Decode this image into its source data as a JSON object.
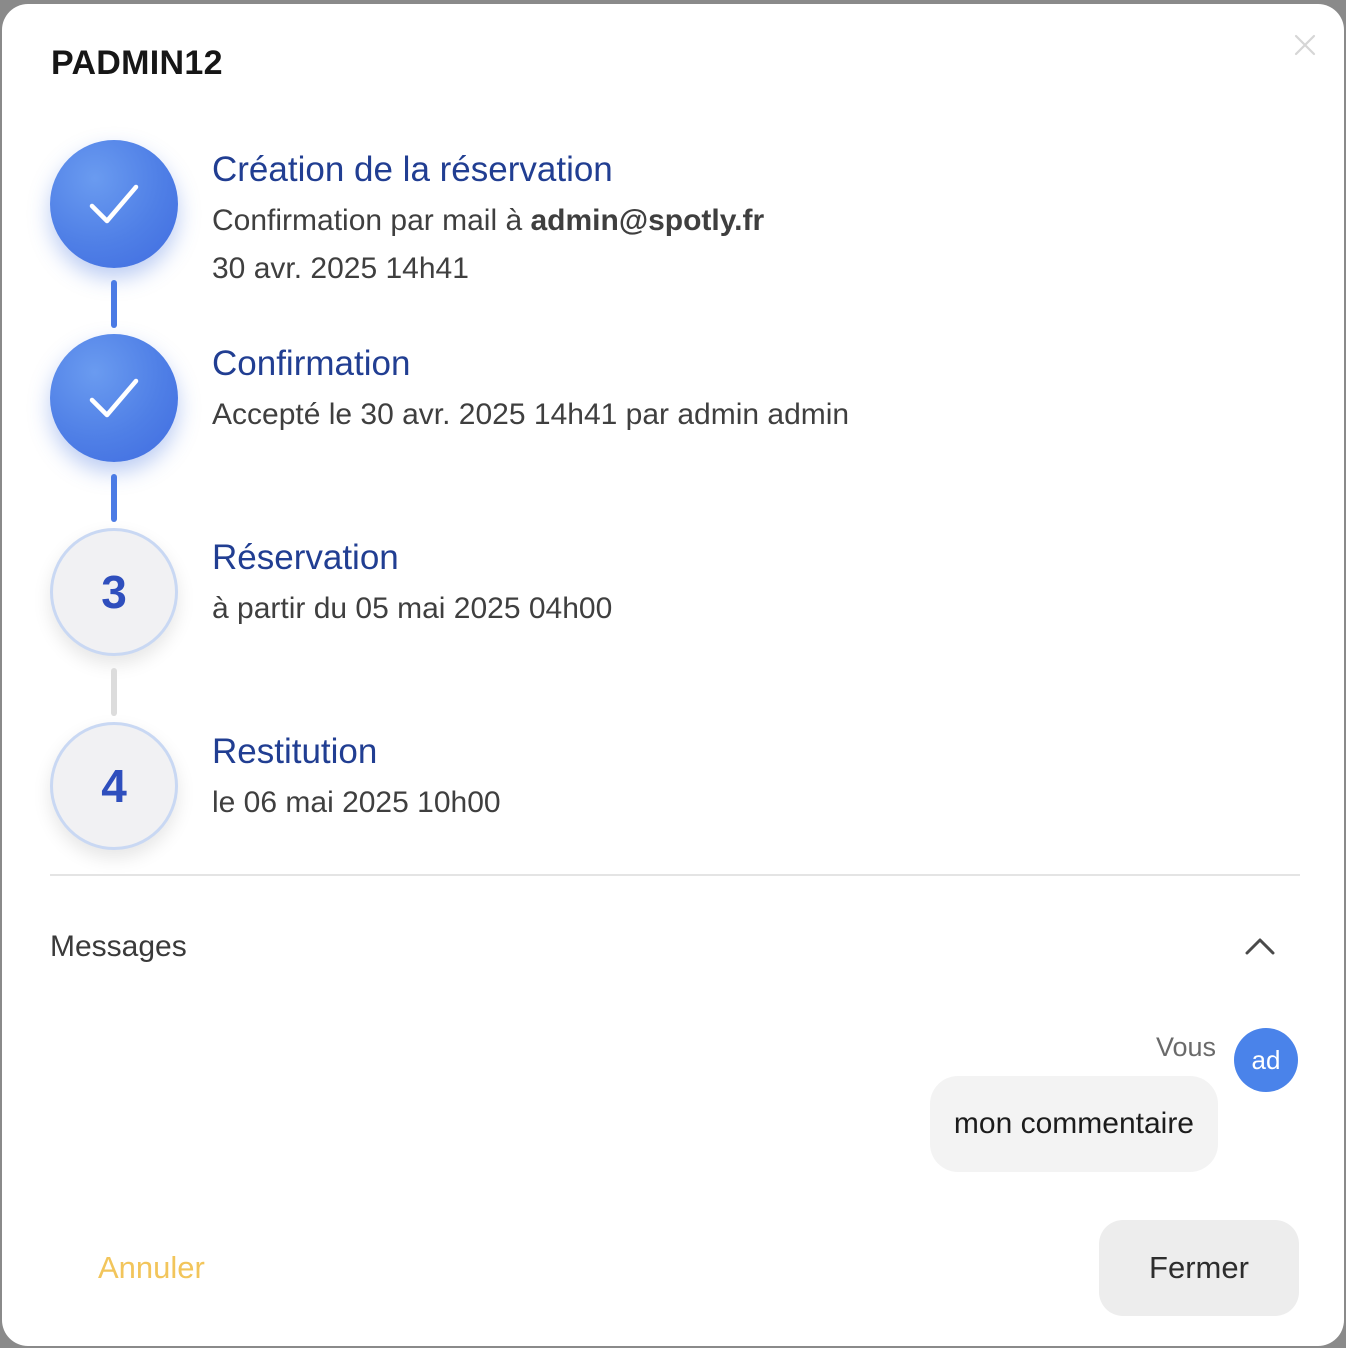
{
  "modal": {
    "title": "PADMIN12"
  },
  "steps": [
    {
      "status": "done",
      "title": "Création de la réservation",
      "line1_prefix": "Confirmation par mail à ",
      "line1_email": "admin@spotly.fr",
      "line2": "30 avr. 2025 14h41"
    },
    {
      "status": "done",
      "title": "Confirmation",
      "line1": "Accepté le 30 avr. 2025 14h41 par admin admin"
    },
    {
      "status": "pending",
      "number": "3",
      "title": "Réservation",
      "line1": "à partir du 05 mai 2025 04h00"
    },
    {
      "status": "pending",
      "number": "4",
      "title": "Restitution",
      "line1": "le 06 mai 2025 10h00"
    }
  ],
  "messages": {
    "label": "Messages",
    "items": [
      {
        "author": "Vous",
        "avatar_initials": "ad",
        "text": "mon commentaire"
      }
    ]
  },
  "footer": {
    "cancel_label": "Annuler",
    "close_label": "Fermer"
  },
  "colors": {
    "accent": "#4a83ea",
    "step_title": "#213e92",
    "cancel": "#f2c55b"
  }
}
